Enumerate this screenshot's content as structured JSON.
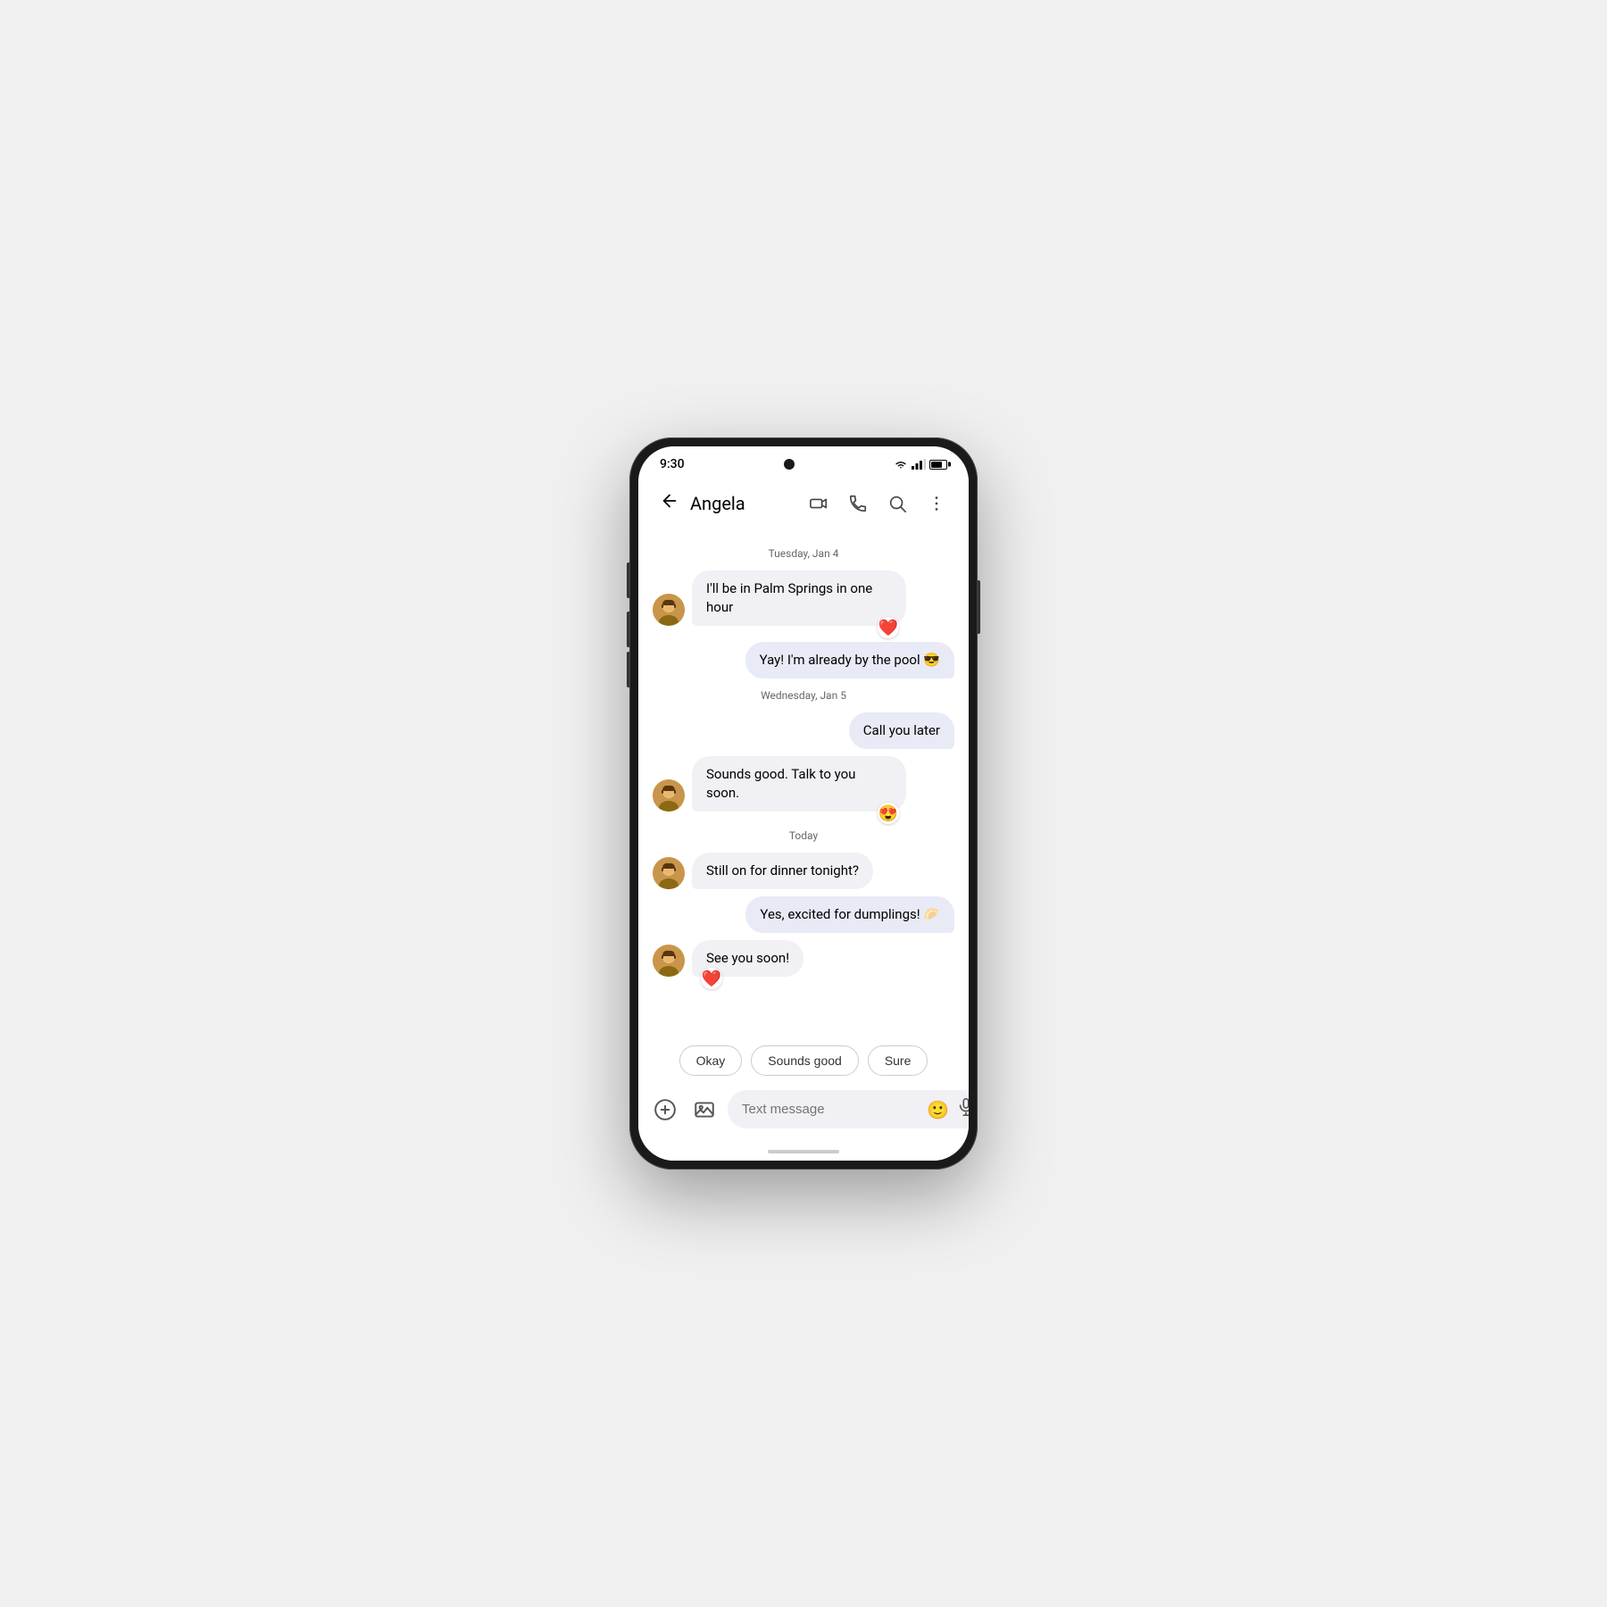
{
  "phone": {
    "status_bar": {
      "time": "9:30"
    },
    "app_bar": {
      "contact_name": "Angela",
      "back_label": "←"
    },
    "messages": [
      {
        "type": "date_divider",
        "text": "Tuesday, Jan 4"
      },
      {
        "type": "incoming",
        "text": "I'll be in Palm Springs in one hour",
        "reaction": "❤️",
        "reaction_side": "right"
      },
      {
        "type": "outgoing",
        "text": "Yay! I'm already by the pool 😎"
      },
      {
        "type": "date_divider",
        "text": "Wednesday, Jan 5"
      },
      {
        "type": "outgoing",
        "text": "Call you later"
      },
      {
        "type": "incoming",
        "text": "Sounds good. Talk to you soon.",
        "reaction": "😍",
        "reaction_side": "right"
      },
      {
        "type": "date_divider",
        "text": "Today"
      },
      {
        "type": "incoming",
        "text": "Still on for dinner tonight?"
      },
      {
        "type": "outgoing",
        "text": "Yes, excited for dumplings! 🥟"
      },
      {
        "type": "incoming",
        "text": "See you soon!",
        "reaction": "❤️",
        "reaction_side": "left"
      }
    ],
    "quick_replies": [
      "Okay",
      "Sounds good",
      "Sure"
    ],
    "input": {
      "placeholder": "Text message"
    }
  }
}
